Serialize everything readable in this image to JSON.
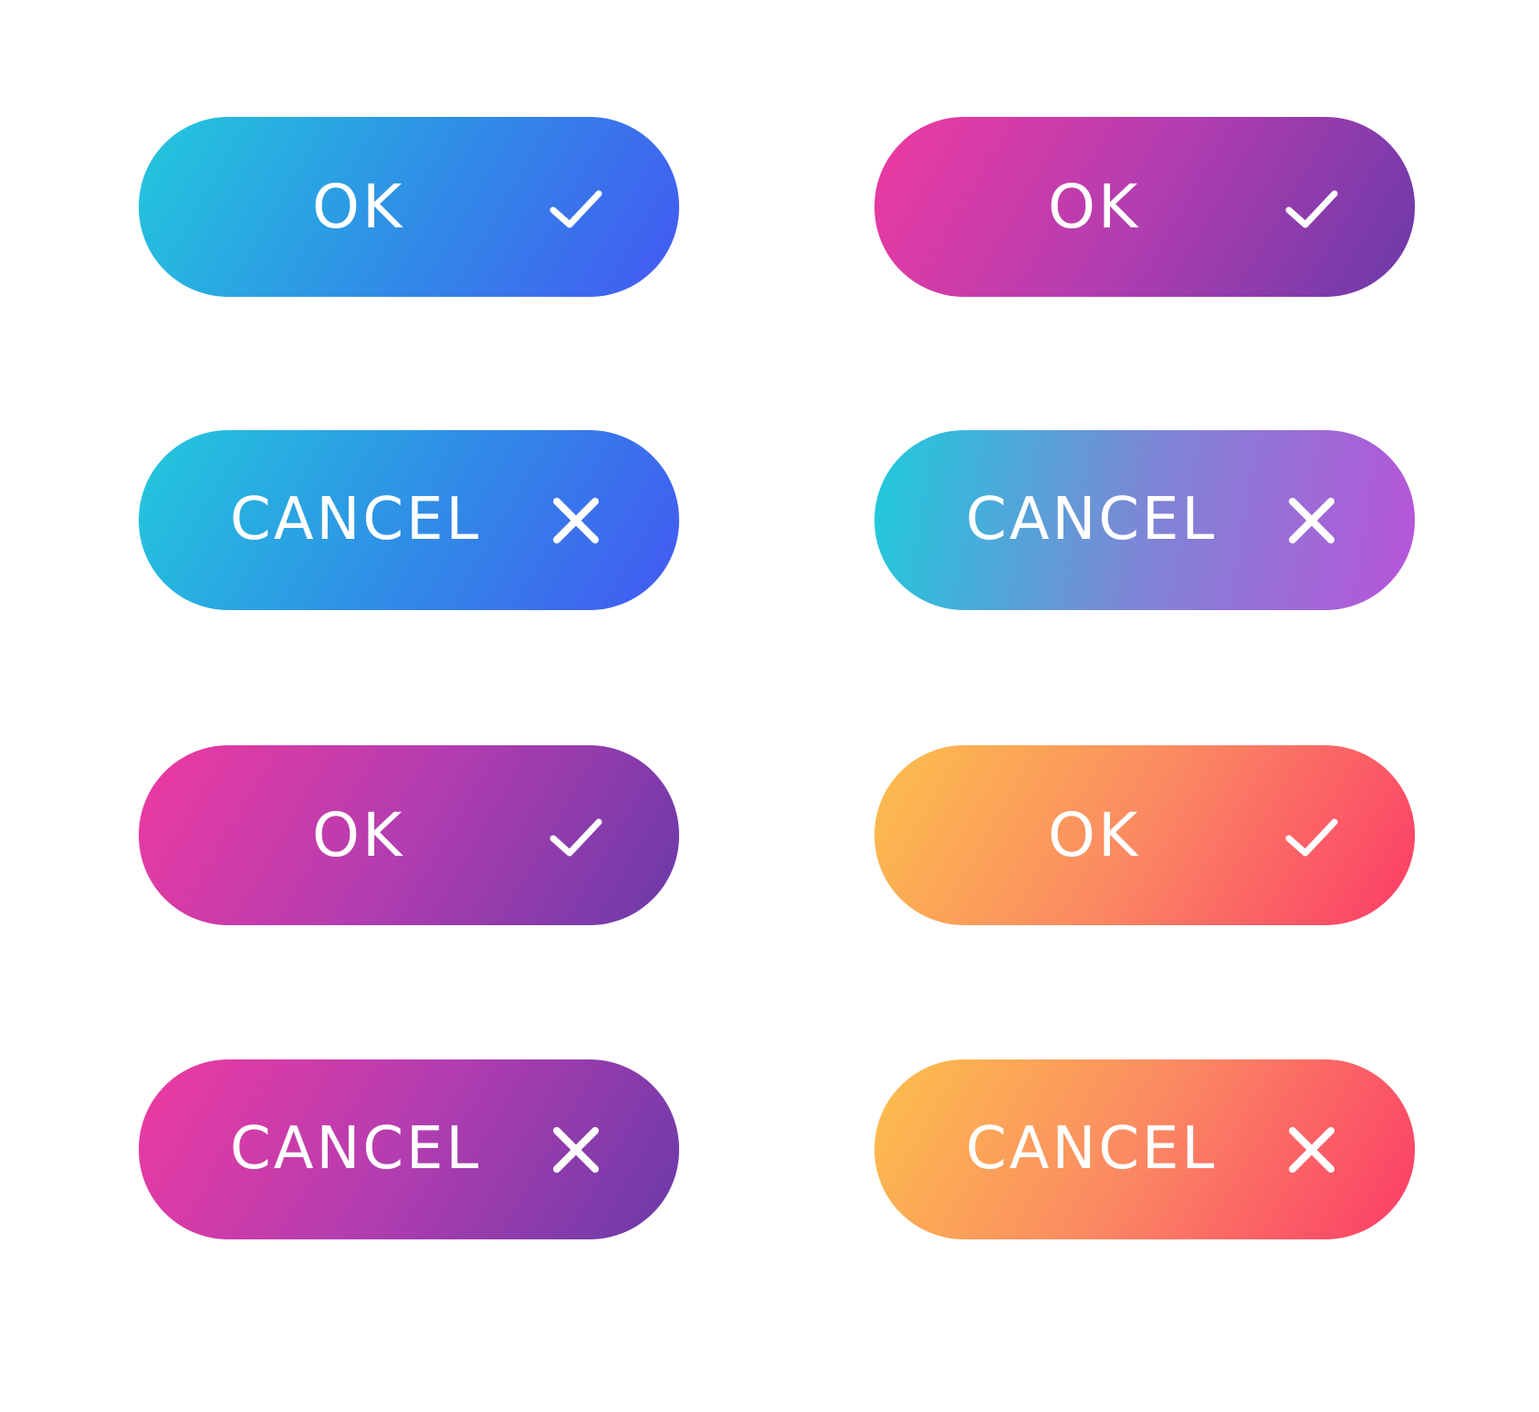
{
  "colors": {
    "blue_gradient": [
      "#22c9dc",
      "#4458f2"
    ],
    "purple_gradient": [
      "#ee3aa0",
      "#6a3aa8"
    ],
    "teal_violet_gradient": [
      "#1ecbdc",
      "#b754d8"
    ],
    "orange_gradient": [
      "#fcc04c",
      "#fb3c68"
    ],
    "text": "#ffffff"
  },
  "buttons": {
    "left": [
      {
        "label": "OK",
        "icon": "check-icon",
        "style": "blue"
      },
      {
        "label": "CANCEL",
        "icon": "close-icon",
        "style": "blue"
      },
      {
        "label": "OK",
        "icon": "check-icon",
        "style": "purple"
      },
      {
        "label": "CANCEL",
        "icon": "close-icon",
        "style": "purple"
      }
    ],
    "right": [
      {
        "label": "OK",
        "icon": "check-icon",
        "style": "purple"
      },
      {
        "label": "CANCEL",
        "icon": "close-icon",
        "style": "teal-violet"
      },
      {
        "label": "OK",
        "icon": "check-icon",
        "style": "orange"
      },
      {
        "label": "CANCEL",
        "icon": "close-icon",
        "style": "orange"
      }
    ]
  }
}
